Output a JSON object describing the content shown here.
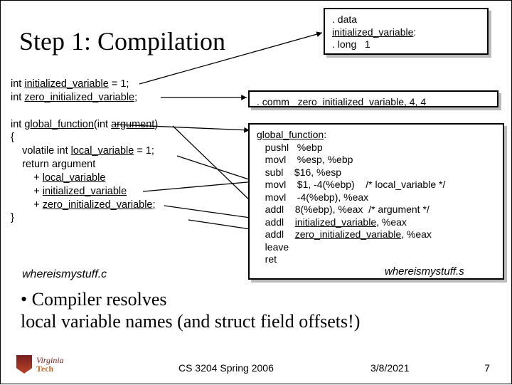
{
  "title": "Step 1: Compilation",
  "data_box": {
    "l1": ". data",
    "l2": "initialized_variable",
    "l2_suffix": ":",
    "l3": ". long   1"
  },
  "comm_box": {
    "prefix": ". comm   ",
    "sym": "zero_initialized_variable",
    "suffix": ", 4, 4"
  },
  "c_code": {
    "l1_a": "int ",
    "l1_b": "initialized_variable",
    "l1_c": " = 1;",
    "l2_a": "int ",
    "l2_b": "zero_initialized_variable",
    "l2_c": ";",
    "blank": " ",
    "l3_a": "int ",
    "l3_b": "global_function",
    "l3_c": "(int ",
    "l3_d": "argument",
    "l3_e": ")",
    "l4": "{",
    "l5_a": "    volatile int ",
    "l5_b": "local_variable",
    "l5_c": " = 1;",
    "l6": "    return argument",
    "l7_a": "        + ",
    "l7_b": "local_variable",
    "l8_a": "        + ",
    "l8_b": "initialized_variable",
    "l9_a": "        + ",
    "l9_b": "zero_initialized_variable",
    "l9_c": ";",
    "l10": "}"
  },
  "asm": {
    "l1_a": "global_function",
    "l1_b": ":",
    "l2": "   pushl   %ebp",
    "l3": "   movl    %esp, %ebp",
    "l4": "   subl    $16, %esp",
    "l5_a": "   movl    $1, -4(%ebp)    ",
    "l5_b": "/* local_variable */",
    "l6": "   movl    -4(%ebp), %eax",
    "l7_a": "   addl    8(%ebp), %eax  ",
    "l7_b": "/* argument */",
    "l8_a": "   addl    ",
    "l8_b": "initialized_variable",
    "l8_c": ", %eax",
    "l9_a": "   addl    ",
    "l9_b": "zero_initialized_variable",
    "l9_c": ", %eax",
    "l10": "   leave",
    "l11": "   ret"
  },
  "filenames": {
    "c": "whereismystuff.c",
    "s": "whereismystuff.s"
  },
  "bullet": "• Compiler resolves\n  local variable names (and struct field offsets!)",
  "footer": {
    "course": "CS 3204 Spring 2006",
    "date": "3/8/2021",
    "page": "7"
  },
  "logo": {
    "line1": "Virginia",
    "line2": "Tech"
  }
}
